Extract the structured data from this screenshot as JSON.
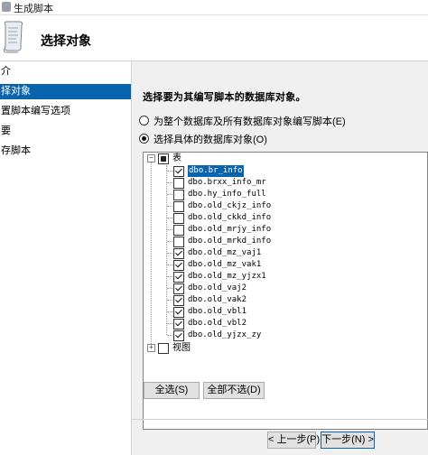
{
  "window": {
    "title": "生成脚本"
  },
  "header": {
    "heading": "选择对象"
  },
  "nav": {
    "items": [
      {
        "label": "介"
      },
      {
        "label": "择对象",
        "selected": true
      },
      {
        "label": "置脚本编写选项"
      },
      {
        "label": "要"
      },
      {
        "label": "存脚本"
      }
    ]
  },
  "main": {
    "instruction": "选择要为其编写脚本的数据库对象。",
    "radio_all": "为整个数据库及所有数据库对象编写脚本(E)",
    "radio_specific": "选择具体的数据库对象(O)"
  },
  "tree": {
    "tables_label": "表",
    "views_label": "视图",
    "items": [
      {
        "name": "dbo.br_info",
        "checked": true,
        "selected": true
      },
      {
        "name": "dbo.brxx_info_mr",
        "checked": false
      },
      {
        "name": "dbo.hy_info_full",
        "checked": false
      },
      {
        "name": "dbo.old_ckjz_info",
        "checked": false
      },
      {
        "name": "dbo.old_ckkd_info",
        "checked": false
      },
      {
        "name": "dbo.old_mrjy_info",
        "checked": false
      },
      {
        "name": "dbo.old_mrkd_info",
        "checked": false
      },
      {
        "name": "dbo.old_mz_vaj1",
        "checked": true
      },
      {
        "name": "dbo.old_mz_vak1",
        "checked": true
      },
      {
        "name": "dbo.old_mz_yjzx1",
        "checked": true
      },
      {
        "name": "dbo.old_vaj2",
        "checked": true
      },
      {
        "name": "dbo.old_vak2",
        "checked": true
      },
      {
        "name": "dbo.old_vbl1",
        "checked": true
      },
      {
        "name": "dbo.old_vbl2",
        "checked": true
      },
      {
        "name": "dbo.old_yjzx_zy",
        "checked": true
      }
    ]
  },
  "buttons": {
    "select_all": "全选(S)",
    "deselect_all": "全部不选(D)",
    "previous": "< 上一步(P)",
    "next": "下一步(N) >"
  },
  "colors": {
    "selection": "#0a64ad"
  }
}
